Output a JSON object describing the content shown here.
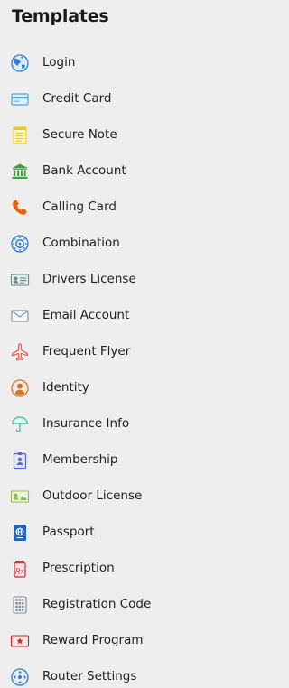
{
  "panel": {
    "title": "Templates"
  },
  "templates": [
    {
      "label": "Login",
      "icon": "globe-icon",
      "color": "#2f7bd6"
    },
    {
      "label": "Credit Card",
      "icon": "credit-card-icon",
      "color": "#4ea6dc"
    },
    {
      "label": "Secure Note",
      "icon": "note-icon",
      "color": "#f2c91a"
    },
    {
      "label": "Bank Account",
      "icon": "bank-icon",
      "color": "#3aa335"
    },
    {
      "label": "Calling Card",
      "icon": "phone-icon",
      "color": "#e8630a"
    },
    {
      "label": "Combination",
      "icon": "combination-dial-icon",
      "color": "#2f7bd6"
    },
    {
      "label": "Drivers License",
      "icon": "id-card-icon",
      "color": "#6b8f8a"
    },
    {
      "label": "Email Account",
      "icon": "envelope-icon",
      "color": "#8a9aac"
    },
    {
      "label": "Frequent Flyer",
      "icon": "airplane-icon",
      "color": "#e0504a"
    },
    {
      "label": "Identity",
      "icon": "person-icon",
      "color": "#d0752a"
    },
    {
      "label": "Insurance Info",
      "icon": "umbrella-icon",
      "color": "#3bbf98"
    },
    {
      "label": "Membership",
      "icon": "badge-icon",
      "color": "#5a66d6"
    },
    {
      "label": "Outdoor License",
      "icon": "outdoor-license-icon",
      "color": "#8fbf4a"
    },
    {
      "label": "Passport",
      "icon": "passport-icon",
      "color": "#1f62c4"
    },
    {
      "label": "Prescription",
      "icon": "prescription-icon",
      "color": "#cc2e3a"
    },
    {
      "label": "Registration Code",
      "icon": "keypad-icon",
      "color": "#7f8a96"
    },
    {
      "label": "Reward Program",
      "icon": "reward-star-icon",
      "color": "#d8242c"
    },
    {
      "label": "Router Settings",
      "icon": "router-icon",
      "color": "#2f7bd6"
    }
  ]
}
